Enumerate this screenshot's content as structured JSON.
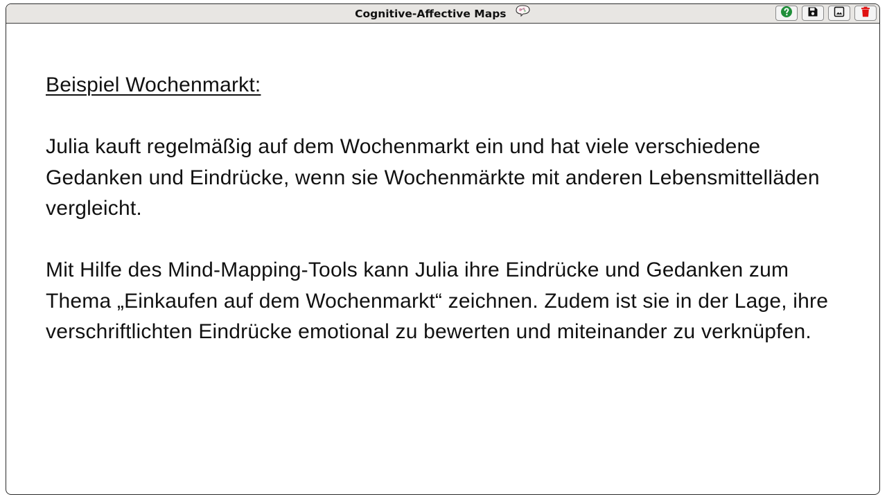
{
  "window": {
    "title": "Cognitive-Affective Maps",
    "logo_icon": "cam-logo-icon"
  },
  "toolbar": {
    "buttons": [
      {
        "name": "help",
        "icon": "question-circle-icon",
        "color": "#1f8f3a"
      },
      {
        "name": "save",
        "icon": "floppy-disk-icon",
        "color": "#111111"
      },
      {
        "name": "image",
        "icon": "image-icon",
        "color": "#111111"
      },
      {
        "name": "delete",
        "icon": "trash-icon",
        "color": "#e01010"
      }
    ]
  },
  "slide": {
    "heading": "Beispiel Wochenmarkt:",
    "paragraph_1": "Julia kauft regelmäßig auf dem Wochenmarkt ein und hat viele verschiedene Gedanken und Eindrücke, wenn sie Wochenmärkte mit anderen Lebensmittelläden vergleicht.",
    "paragraph_2": "Mit Hilfe des Mind-Mapping-Tools kann Julia ihre Eindrücke und Gedanken zum Thema „Einkaufen auf dem Wochenmarkt“ zeichnen. Zudem ist sie in der Lage, ihre verschriftlichten Eindrücke emotional zu bewerten und miteinander zu verknüpfen."
  }
}
